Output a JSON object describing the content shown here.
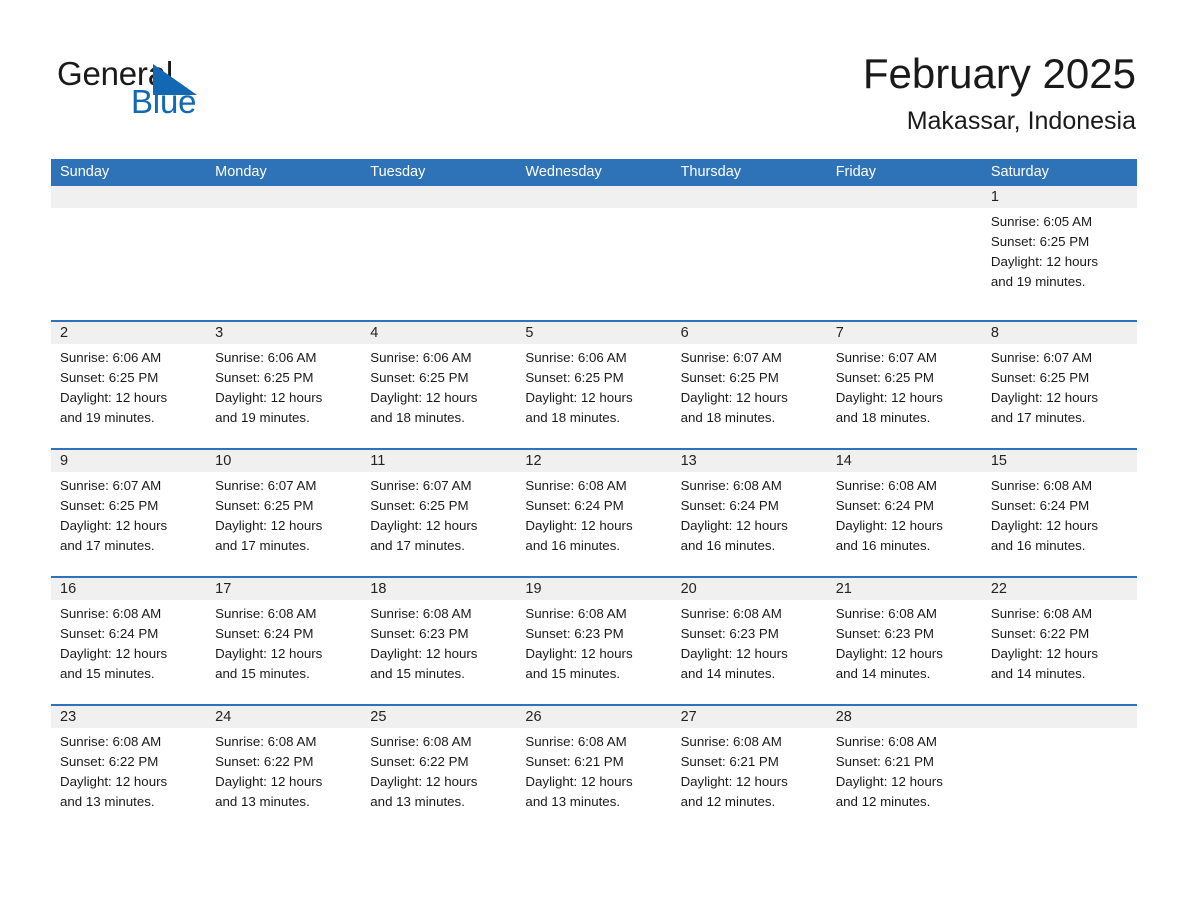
{
  "brand": {
    "name_part1": "General",
    "name_part2": "Blue",
    "triangle_color": "#1268b3",
    "blue_color": "#1268b3"
  },
  "header": {
    "title": "February 2025",
    "location": "Makassar, Indonesia"
  },
  "theme": {
    "header_blue": "#2e72b8",
    "daynum_gray": "#f0f0f0",
    "text": "#1a1a1a"
  },
  "weekdays": [
    "Sunday",
    "Monday",
    "Tuesday",
    "Wednesday",
    "Thursday",
    "Friday",
    "Saturday"
  ],
  "weeks": [
    [
      {
        "day": "",
        "empty": true
      },
      {
        "day": "",
        "empty": true
      },
      {
        "day": "",
        "empty": true
      },
      {
        "day": "",
        "empty": true
      },
      {
        "day": "",
        "empty": true
      },
      {
        "day": "",
        "empty": true
      },
      {
        "day": "1",
        "sunrise": "Sunrise: 6:05 AM",
        "sunset": "Sunset: 6:25 PM",
        "daylight1": "Daylight: 12 hours",
        "daylight2": "and 19 minutes."
      }
    ],
    [
      {
        "day": "2",
        "sunrise": "Sunrise: 6:06 AM",
        "sunset": "Sunset: 6:25 PM",
        "daylight1": "Daylight: 12 hours",
        "daylight2": "and 19 minutes."
      },
      {
        "day": "3",
        "sunrise": "Sunrise: 6:06 AM",
        "sunset": "Sunset: 6:25 PM",
        "daylight1": "Daylight: 12 hours",
        "daylight2": "and 19 minutes."
      },
      {
        "day": "4",
        "sunrise": "Sunrise: 6:06 AM",
        "sunset": "Sunset: 6:25 PM",
        "daylight1": "Daylight: 12 hours",
        "daylight2": "and 18 minutes."
      },
      {
        "day": "5",
        "sunrise": "Sunrise: 6:06 AM",
        "sunset": "Sunset: 6:25 PM",
        "daylight1": "Daylight: 12 hours",
        "daylight2": "and 18 minutes."
      },
      {
        "day": "6",
        "sunrise": "Sunrise: 6:07 AM",
        "sunset": "Sunset: 6:25 PM",
        "daylight1": "Daylight: 12 hours",
        "daylight2": "and 18 minutes."
      },
      {
        "day": "7",
        "sunrise": "Sunrise: 6:07 AM",
        "sunset": "Sunset: 6:25 PM",
        "daylight1": "Daylight: 12 hours",
        "daylight2": "and 18 minutes."
      },
      {
        "day": "8",
        "sunrise": "Sunrise: 6:07 AM",
        "sunset": "Sunset: 6:25 PM",
        "daylight1": "Daylight: 12 hours",
        "daylight2": "and 17 minutes."
      }
    ],
    [
      {
        "day": "9",
        "sunrise": "Sunrise: 6:07 AM",
        "sunset": "Sunset: 6:25 PM",
        "daylight1": "Daylight: 12 hours",
        "daylight2": "and 17 minutes."
      },
      {
        "day": "10",
        "sunrise": "Sunrise: 6:07 AM",
        "sunset": "Sunset: 6:25 PM",
        "daylight1": "Daylight: 12 hours",
        "daylight2": "and 17 minutes."
      },
      {
        "day": "11",
        "sunrise": "Sunrise: 6:07 AM",
        "sunset": "Sunset: 6:25 PM",
        "daylight1": "Daylight: 12 hours",
        "daylight2": "and 17 minutes."
      },
      {
        "day": "12",
        "sunrise": "Sunrise: 6:08 AM",
        "sunset": "Sunset: 6:24 PM",
        "daylight1": "Daylight: 12 hours",
        "daylight2": "and 16 minutes."
      },
      {
        "day": "13",
        "sunrise": "Sunrise: 6:08 AM",
        "sunset": "Sunset: 6:24 PM",
        "daylight1": "Daylight: 12 hours",
        "daylight2": "and 16 minutes."
      },
      {
        "day": "14",
        "sunrise": "Sunrise: 6:08 AM",
        "sunset": "Sunset: 6:24 PM",
        "daylight1": "Daylight: 12 hours",
        "daylight2": "and 16 minutes."
      },
      {
        "day": "15",
        "sunrise": "Sunrise: 6:08 AM",
        "sunset": "Sunset: 6:24 PM",
        "daylight1": "Daylight: 12 hours",
        "daylight2": "and 16 minutes."
      }
    ],
    [
      {
        "day": "16",
        "sunrise": "Sunrise: 6:08 AM",
        "sunset": "Sunset: 6:24 PM",
        "daylight1": "Daylight: 12 hours",
        "daylight2": "and 15 minutes."
      },
      {
        "day": "17",
        "sunrise": "Sunrise: 6:08 AM",
        "sunset": "Sunset: 6:24 PM",
        "daylight1": "Daylight: 12 hours",
        "daylight2": "and 15 minutes."
      },
      {
        "day": "18",
        "sunrise": "Sunrise: 6:08 AM",
        "sunset": "Sunset: 6:23 PM",
        "daylight1": "Daylight: 12 hours",
        "daylight2": "and 15 minutes."
      },
      {
        "day": "19",
        "sunrise": "Sunrise: 6:08 AM",
        "sunset": "Sunset: 6:23 PM",
        "daylight1": "Daylight: 12 hours",
        "daylight2": "and 15 minutes."
      },
      {
        "day": "20",
        "sunrise": "Sunrise: 6:08 AM",
        "sunset": "Sunset: 6:23 PM",
        "daylight1": "Daylight: 12 hours",
        "daylight2": "and 14 minutes."
      },
      {
        "day": "21",
        "sunrise": "Sunrise: 6:08 AM",
        "sunset": "Sunset: 6:23 PM",
        "daylight1": "Daylight: 12 hours",
        "daylight2": "and 14 minutes."
      },
      {
        "day": "22",
        "sunrise": "Sunrise: 6:08 AM",
        "sunset": "Sunset: 6:22 PM",
        "daylight1": "Daylight: 12 hours",
        "daylight2": "and 14 minutes."
      }
    ],
    [
      {
        "day": "23",
        "sunrise": "Sunrise: 6:08 AM",
        "sunset": "Sunset: 6:22 PM",
        "daylight1": "Daylight: 12 hours",
        "daylight2": "and 13 minutes."
      },
      {
        "day": "24",
        "sunrise": "Sunrise: 6:08 AM",
        "sunset": "Sunset: 6:22 PM",
        "daylight1": "Daylight: 12 hours",
        "daylight2": "and 13 minutes."
      },
      {
        "day": "25",
        "sunrise": "Sunrise: 6:08 AM",
        "sunset": "Sunset: 6:22 PM",
        "daylight1": "Daylight: 12 hours",
        "daylight2": "and 13 minutes."
      },
      {
        "day": "26",
        "sunrise": "Sunrise: 6:08 AM",
        "sunset": "Sunset: 6:21 PM",
        "daylight1": "Daylight: 12 hours",
        "daylight2": "and 13 minutes."
      },
      {
        "day": "27",
        "sunrise": "Sunrise: 6:08 AM",
        "sunset": "Sunset: 6:21 PM",
        "daylight1": "Daylight: 12 hours",
        "daylight2": "and 12 minutes."
      },
      {
        "day": "28",
        "sunrise": "Sunrise: 6:08 AM",
        "sunset": "Sunset: 6:21 PM",
        "daylight1": "Daylight: 12 hours",
        "daylight2": "and 12 minutes."
      },
      {
        "day": "",
        "empty": true
      }
    ]
  ]
}
